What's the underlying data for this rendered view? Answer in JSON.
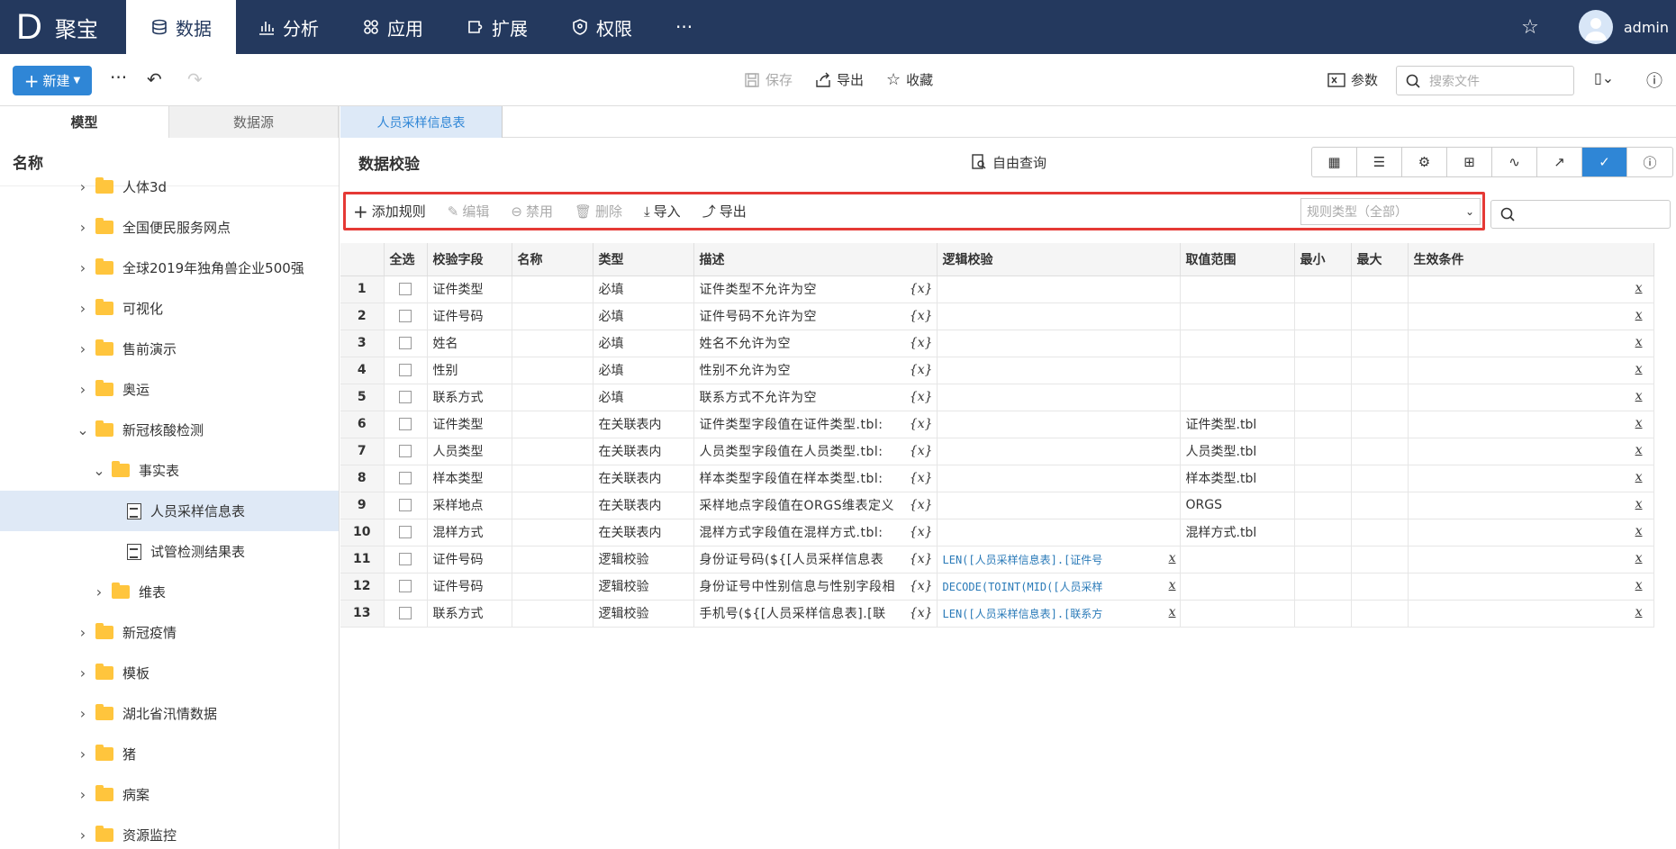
{
  "app": {
    "logo_letter": "D",
    "name": "聚宝",
    "user": "admin"
  },
  "nav": [
    {
      "label": "数据",
      "icon": "database-icon"
    },
    {
      "label": "分析",
      "icon": "chart-icon"
    },
    {
      "label": "应用",
      "icon": "apps-icon"
    },
    {
      "label": "扩展",
      "icon": "extension-icon"
    },
    {
      "label": "权限",
      "icon": "shield-icon"
    },
    {
      "label": "···",
      "icon": "more-icon"
    }
  ],
  "toolbar": {
    "new_label": "新建",
    "save_label": "保存",
    "export_label": "导出",
    "favorite_label": "收藏",
    "param_label": "参数",
    "search_placeholder": "搜索文件"
  },
  "left": {
    "tabs": [
      "模型",
      "数据源"
    ],
    "header": "名称",
    "tree": [
      {
        "label": "人体3d",
        "type": "folder",
        "level": 0,
        "expanded": false
      },
      {
        "label": "全国便民服务网点",
        "type": "folder",
        "level": 0,
        "expanded": false
      },
      {
        "label": "全球2019年独角兽企业500强",
        "type": "folder",
        "level": 0,
        "expanded": false
      },
      {
        "label": "可视化",
        "type": "folder",
        "level": 0,
        "expanded": false
      },
      {
        "label": "售前演示",
        "type": "folder",
        "level": 0,
        "expanded": false
      },
      {
        "label": "奥运",
        "type": "folder",
        "level": 0,
        "expanded": false
      },
      {
        "label": "新冠核酸检测",
        "type": "folder",
        "level": 0,
        "expanded": true
      },
      {
        "label": "事实表",
        "type": "folder",
        "level": 1,
        "expanded": true
      },
      {
        "label": "人员采样信息表",
        "type": "file",
        "level": 2,
        "selected": true
      },
      {
        "label": "试管检测结果表",
        "type": "file",
        "level": 2
      },
      {
        "label": "维表",
        "type": "folder",
        "level": 1,
        "expanded": false
      },
      {
        "label": "新冠疫情",
        "type": "folder",
        "level": 0,
        "expanded": false
      },
      {
        "label": "模板",
        "type": "folder",
        "level": 0,
        "expanded": false
      },
      {
        "label": "湖北省汛情数据",
        "type": "folder",
        "level": 0,
        "expanded": false
      },
      {
        "label": "猪",
        "type": "folder",
        "level": 0,
        "expanded": false
      },
      {
        "label": "病案",
        "type": "folder",
        "level": 0,
        "expanded": false
      },
      {
        "label": "资源监控",
        "type": "folder",
        "level": 0,
        "expanded": false
      }
    ]
  },
  "main": {
    "doc_tab": "人员采样信息表",
    "title": "数据校验",
    "free_query": "自由查询",
    "actions": {
      "add": "添加规则",
      "edit": "编辑",
      "disable": "禁用",
      "delete": "删除",
      "import": "导入",
      "export": "导出"
    },
    "rule_type_placeholder": "规则类型（全部）",
    "columns": [
      "全选",
      "校验字段",
      "名称",
      "类型",
      "描述",
      "逻辑校验",
      "取值范围",
      "最小",
      "最大",
      "生效条件"
    ],
    "rows": [
      {
        "n": "1",
        "field": "证件类型",
        "type": "必填",
        "desc": "证件类型不允许为空",
        "logic": "",
        "range": ""
      },
      {
        "n": "2",
        "field": "证件号码",
        "type": "必填",
        "desc": "证件号码不允许为空",
        "logic": "",
        "range": ""
      },
      {
        "n": "3",
        "field": "姓名",
        "type": "必填",
        "desc": "姓名不允许为空",
        "logic": "",
        "range": ""
      },
      {
        "n": "4",
        "field": "性别",
        "type": "必填",
        "desc": "性别不允许为空",
        "logic": "",
        "range": ""
      },
      {
        "n": "5",
        "field": "联系方式",
        "type": "必填",
        "desc": "联系方式不允许为空",
        "logic": "",
        "range": ""
      },
      {
        "n": "6",
        "field": "证件类型",
        "type": "在关联表内",
        "desc": "证件类型字段值在证件类型.tbl:",
        "logic": "",
        "range": "证件类型.tbl"
      },
      {
        "n": "7",
        "field": "人员类型",
        "type": "在关联表内",
        "desc": "人员类型字段值在人员类型.tbl:",
        "logic": "",
        "range": "人员类型.tbl"
      },
      {
        "n": "8",
        "field": "样本类型",
        "type": "在关联表内",
        "desc": "样本类型字段值在样本类型.tbl:",
        "logic": "",
        "range": "样本类型.tbl"
      },
      {
        "n": "9",
        "field": "采样地点",
        "type": "在关联表内",
        "desc": "采样地点字段值在ORGS维表定义",
        "logic": "",
        "range": "ORGS"
      },
      {
        "n": "10",
        "field": "混样方式",
        "type": "在关联表内",
        "desc": "混样方式字段值在混样方式.tbl:",
        "logic": "",
        "range": "混样方式.tbl"
      },
      {
        "n": "11",
        "field": "证件号码",
        "type": "逻辑校验",
        "desc": "身份证号码(${[人员采样信息表",
        "logic": "LEN([人员采样信息表].[证件号",
        "range": ""
      },
      {
        "n": "12",
        "field": "证件号码",
        "type": "逻辑校验",
        "desc": "身份证号中性别信息与性别字段相",
        "logic": "DECODE(TOINT(MID([人员采样",
        "range": ""
      },
      {
        "n": "13",
        "field": "联系方式",
        "type": "逻辑校验",
        "desc": "手机号(${[人员采样信息表].[联",
        "logic": "LEN([人员采样信息表].[联系方",
        "range": ""
      }
    ]
  },
  "colors": {
    "nav_bg": "#24395e",
    "accent": "#2f86d6",
    "highlight_border": "#e53935"
  }
}
